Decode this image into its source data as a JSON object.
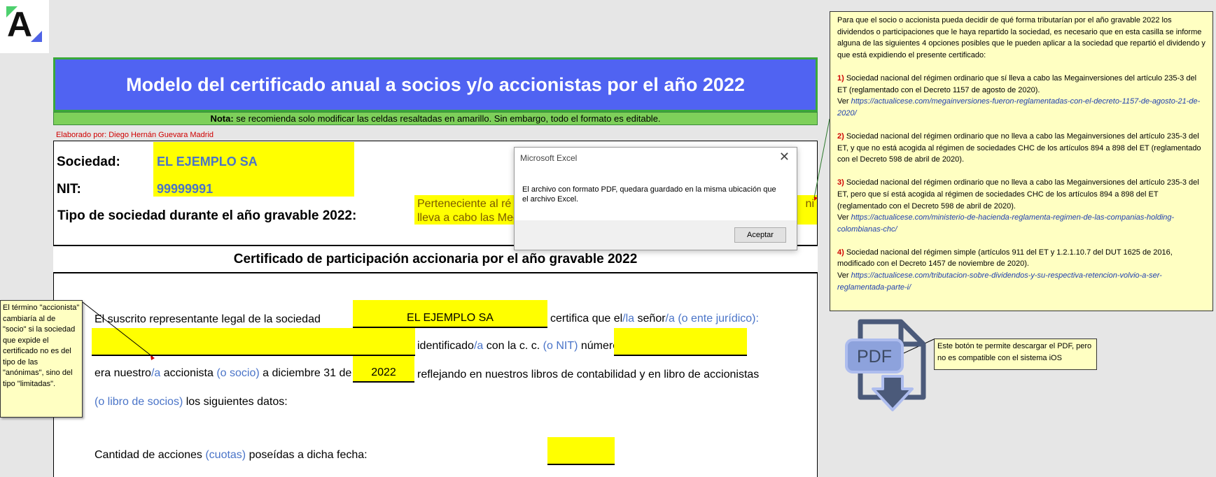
{
  "logo": {
    "letter": "A",
    "colors": {
      "green": "#4dd06e",
      "blue": "#4f63e6"
    }
  },
  "header": {
    "title": "Modelo del certificado anual a socios y/o accionistas por el año 2022",
    "note_label": "Nota:",
    "note_text": " se recomienda solo modificar las celdas resaltadas en amarillo. Sin embargo, todo el formato es editable.",
    "author": "Elaborado por: Diego Hernán Guevara Madrid"
  },
  "company": {
    "sociedad_label": "Sociedad:",
    "sociedad_value": "EL EJEMPLO SA",
    "nit_label": "NIT:",
    "nit_value": "99999991",
    "tipo_label": "Tipo de sociedad durante el año gravable 2022:",
    "tipo_line1_start": "Perteneciente al ré",
    "tipo_line1_end": "ni",
    "tipo_line2": "lleva a cabo las Meg"
  },
  "certificate": {
    "heading": "Certificado de participación accionaria por el año gravable 2022",
    "l1_text": "El suscrito representante legal de la sociedad",
    "l1_company": "EL EJEMPLO SA",
    "l1_certifica": "certifica que el",
    "l1_la": "/la",
    "l1_senor": " señor",
    "l1_ente": "/a (o ente jurídico):",
    "l2_ident": "identificado",
    "l2_a": "/a",
    "l2_cc": " con la c. c.",
    "l2_nit": " (o NIT)",
    "l2_numero": " número",
    "l3_era": "era nuestro",
    "l3_a": "/a",
    "l3_accionista": " accionista",
    "l3_socio": " (o socio)",
    "l3_dic": " a diciembre 31 de",
    "l3_year": "2022",
    "l3_reflejando": "reflejando en nuestros libros de contabilidad y en libro de accionistas",
    "l4_libro": "(o libro de socios)",
    "l4_datos": " los siguientes datos:",
    "l5_cantidad": "Cantidad de acciones",
    "l5_cuotas": " (cuotas)",
    "l5_poseidas": " poseídas a dicha fecha:"
  },
  "dialog": {
    "title": "Microsoft Excel",
    "close": "✕",
    "message": "El archivo con formato PDF, quedara guardado en la misma ubicación que el archivo Excel.",
    "ok": "Aceptar"
  },
  "comment_right": {
    "intro": "Para que el socio o accionista pueda decidir de qué forma tributarían por el año gravable 2022 los dividendos o participaciones que le haya repartido la sociedad, es necesario que en esta casilla se informe alguna de las siguientes 4 opciones posibles que le pueden aplicar a la sociedad que repartió el dividendo y que está expidiendo el presente certificado:",
    "opt1_num": "1)",
    "opt1_text": " Sociedad nacional del régimen ordinario que sí lleva a cabo las Megainversiones del artículo 235-3 del ET (reglamentado con el Decreto 1157 de agosto de 2020).",
    "opt1_ver": "Ver ",
    "opt1_link": "https://actualicese.com/megainversiones-fueron-reglamentadas-con-el-decreto-1157-de-agosto-21-de-2020/",
    "opt2_num": "2)",
    "opt2_text": " Sociedad nacional del régimen ordinario que no lleva a cabo las Megainversiones del artículo 235-3 del ET, y que no está acogida al régimen de sociedades CHC de los artículos 894 a 898 del ET (reglamentado con el Decreto 598 de abril de 2020).",
    "opt3_num": "3)",
    "opt3_text": "  Sociedad nacional del régimen ordinario que no lleva a cabo las Megainversiones del artículo 235-3 del ET, pero que sí está acogida al régimen de sociedades CHC de los artículos 894 a 898 del ET (reglamentado con el Decreto 598 de abril de 2020).",
    "opt3_ver": "Ver ",
    "opt3_link": "https://actualicese.com/ministerio-de-hacienda-reglamenta-regimen-de-las-companias-holding-colombianas-chc/",
    "opt4_num": "4)",
    "opt4_text": " Sociedad nacional del régimen simple (artículos 911 del ET y 1.2.1.10.7 del DUT 1625 de 2016, modificado con el Decreto 1457 de noviembre de 2020).",
    "opt4_ver": "Ver ",
    "opt4_link": "https://actualicese.com/tributacion-sobre-dividendos-y-su-respectiva-retencion-volvio-a-ser-reglamentada-parte-i/"
  },
  "comment_left": {
    "text": "El término \"accionista\" cambiaría al de \"socio\" si la sociedad que expide el certificado no es del tipo de las \"anónimas\", sino del tipo \"limitadas\"."
  },
  "pdf": {
    "label": "PDF",
    "icon": "pdf-download-icon",
    "comment": "Este botón te permite descargar el PDF, pero no es compatible con el sistema iOS"
  },
  "colors": {
    "title_bg": "#5063f2",
    "note_bg": "#7ed05a",
    "highlight": "#ffff00",
    "blue_text": "#4a74c8",
    "comment_bg": "#ffffc2"
  }
}
